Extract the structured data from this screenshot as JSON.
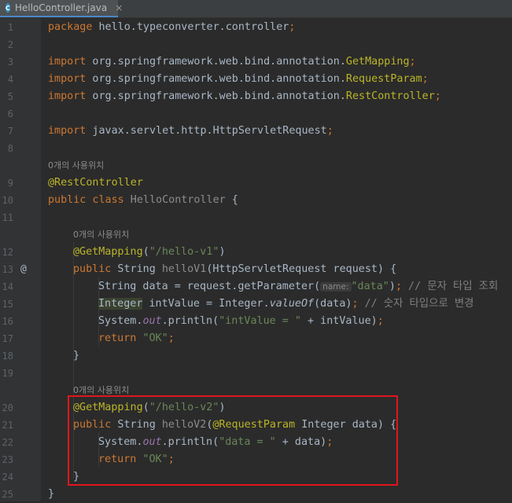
{
  "tab": {
    "file_name": "HelloController.java",
    "icon_letter": "C",
    "close_glyph": "×"
  },
  "gutter": {
    "at_marker": "@"
  },
  "usage_hint": "0개의 사용위치",
  "inlay_param": "name:",
  "lines": {
    "l1": {
      "num": "1",
      "t1": "package",
      "t2": " hello.typeconverter.controller",
      "t3": ";"
    },
    "l2": {
      "num": "2"
    },
    "l3": {
      "num": "3",
      "t1": "import",
      "t2": " org.springframework.web.bind.annotation.",
      "t3": "GetMapping",
      "t4": ";"
    },
    "l4": {
      "num": "4",
      "t1": "import",
      "t2": " org.springframework.web.bind.annotation.",
      "t3": "RequestParam",
      "t4": ";"
    },
    "l5": {
      "num": "5",
      "t1": "import",
      "t2": " org.springframework.web.bind.annotation.",
      "t3": "RestController",
      "t4": ";"
    },
    "l6": {
      "num": "6"
    },
    "l7": {
      "num": "7",
      "t1": "import",
      "t2": " javax.servlet.http.HttpServletRequest",
      "t3": ";"
    },
    "l8": {
      "num": "8"
    },
    "l9": {
      "num": "9",
      "t1": "@RestController"
    },
    "l10": {
      "num": "10",
      "t1": "public class",
      "t2": " HelloController",
      "t3": " {"
    },
    "l11": {
      "num": "11"
    },
    "l12": {
      "num": "12",
      "t1": "@GetMapping",
      "t2": "(",
      "t3": "\"/hello-v1\"",
      "t4": ")"
    },
    "l13": {
      "num": "13",
      "t1": "public",
      "t2": " String ",
      "t3": "helloV1",
      "t4": "(HttpServletRequest request) {"
    },
    "l14": {
      "num": "14",
      "t1": "String data = request.getParameter(",
      "t2": "\"data\"",
      "t3": ")",
      "t4": ";",
      "t5": " // 문자 타입 조회"
    },
    "l15": {
      "num": "15",
      "t1": "Integer",
      "t2": " intValue = Integer.",
      "t3": "valueOf",
      "t4": "(data)",
      "t5": ";",
      "t6": " // 숫자 타입으로 변경"
    },
    "l16": {
      "num": "16",
      "t1": "System.",
      "t2": "out",
      "t3": ".println(",
      "t4": "\"intValue = \"",
      "t5": " + intValue)",
      "t6": ";"
    },
    "l17": {
      "num": "17",
      "t1": "return",
      "t2": " \"OK\"",
      "t3": ";"
    },
    "l18": {
      "num": "18",
      "t1": "}"
    },
    "l19": {
      "num": "19"
    },
    "l20": {
      "num": "20",
      "t1": "@GetMapping",
      "t2": "(",
      "t3": "\"/hello-v2\"",
      "t4": ")"
    },
    "l21": {
      "num": "21",
      "t1": "public",
      "t2": " String ",
      "t3": "helloV2",
      "t4": "(",
      "t5": "@RequestParam",
      "t6": " Integer data) {"
    },
    "l22": {
      "num": "22",
      "t1": "System.",
      "t2": "out",
      "t3": ".println(",
      "t4": "\"data = \"",
      "t5": " + data)",
      "t6": ";"
    },
    "l23": {
      "num": "23",
      "t1": "return",
      "t2": " \"OK\"",
      "t3": ";"
    },
    "l24": {
      "num": "24",
      "t1": "}"
    },
    "l25": {
      "num": "25",
      "t1": "}"
    }
  },
  "colors": {
    "background": "#2b2b2b",
    "keyword": "#cc7832",
    "annotation": "#bbb529",
    "string": "#6a8759",
    "method": "#ffc66d",
    "field": "#9876aa",
    "highlight_box": "#e0161c"
  }
}
